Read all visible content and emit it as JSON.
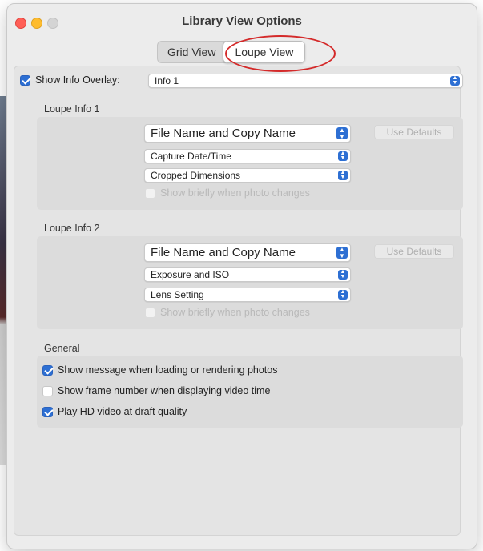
{
  "window": {
    "title": "Library View Options"
  },
  "tabs": [
    {
      "label": "Grid View"
    },
    {
      "label": "Loupe View"
    }
  ],
  "overlay": {
    "label": "Show Info Overlay:",
    "checked": true,
    "value": "Info 1"
  },
  "loupe_info_1": {
    "title": "Loupe Info 1",
    "line1": "File Name and Copy Name",
    "line2": "Capture Date/Time",
    "line3": "Cropped Dimensions",
    "use_defaults": "Use Defaults",
    "show_briefly": "Show briefly when photo changes"
  },
  "loupe_info_2": {
    "title": "Loupe Info 2",
    "line1": "File Name and Copy Name",
    "line2": "Exposure and ISO",
    "line3": "Lens Setting",
    "use_defaults": "Use Defaults",
    "show_briefly": "Show briefly when photo changes"
  },
  "general": {
    "title": "General",
    "options": [
      {
        "label": "Show message when loading or rendering photos",
        "checked": true
      },
      {
        "label": "Show frame number when displaying video time",
        "checked": false
      },
      {
        "label": "Play HD video at draft quality",
        "checked": true
      }
    ]
  },
  "colors": {
    "accent": "#2d6fd3",
    "highlight_ring": "#d42a2a"
  }
}
